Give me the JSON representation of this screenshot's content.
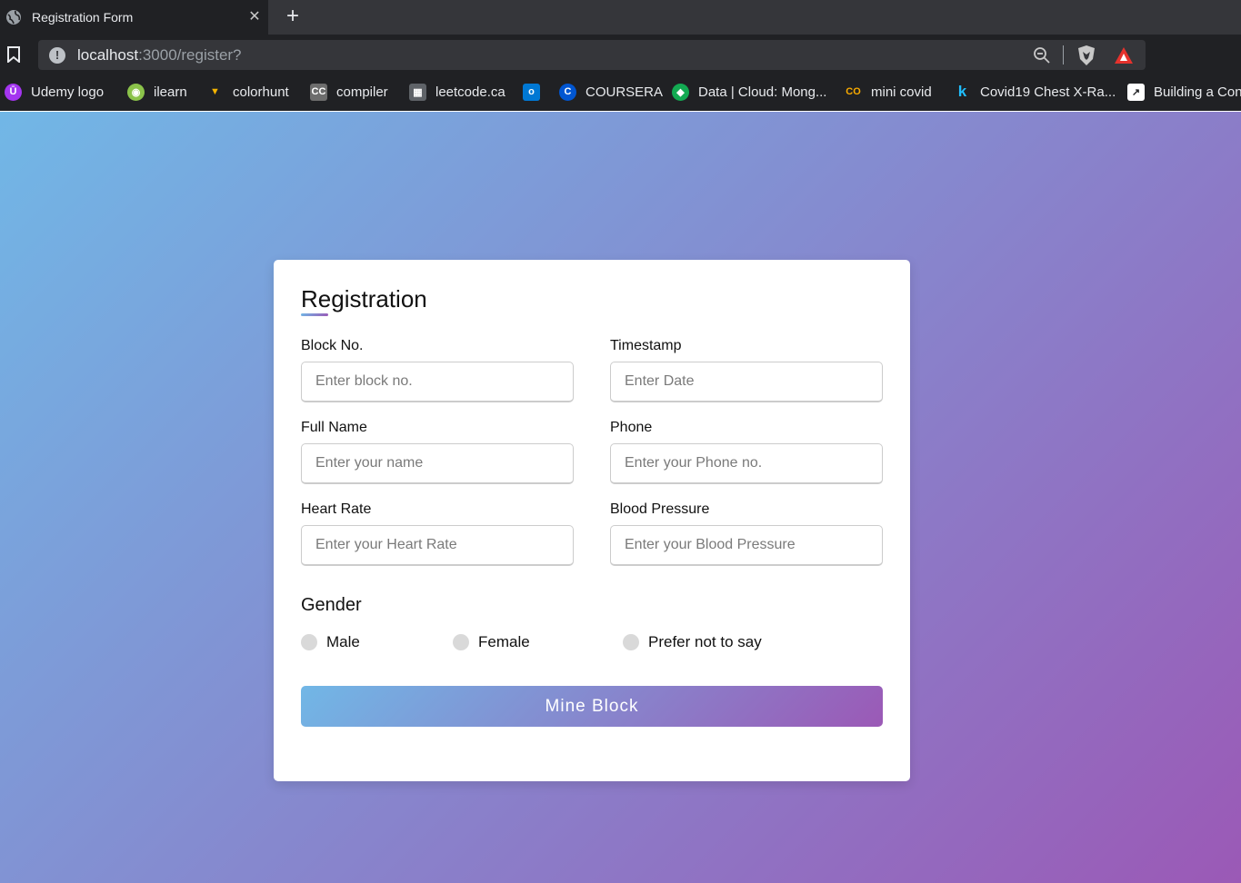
{
  "browser": {
    "tab": {
      "title": "Registration Form",
      "close_glyph": "✕"
    },
    "new_tab_glyph": "+",
    "url": {
      "host": "localhost",
      "path": ":3000/register?"
    },
    "bookmarks": [
      {
        "label": "Udemy logo",
        "icon": "udemy-icon",
        "color": "#a435f0",
        "glyph": "Ū"
      },
      {
        "label": "ilearn",
        "icon": "ilearn-icon",
        "color": "#8bc34a",
        "glyph": "◉"
      },
      {
        "label": "colorhunt",
        "icon": "colorhunt-icon",
        "color": "#f4b400",
        "glyph": "▼"
      },
      {
        "label": "compiler",
        "icon": "compiler-icon",
        "color": "#6d6d6d",
        "glyph": "CC"
      },
      {
        "label": "leetcode.ca",
        "icon": "leetcode-icon",
        "color": "#5f6368",
        "glyph": "▦"
      },
      {
        "label": "",
        "icon": "outlook-icon",
        "color": "#0078d4",
        "glyph": "o"
      },
      {
        "label": "COURSERA",
        "icon": "coursera-icon",
        "color": "#0056d2",
        "glyph": "C"
      },
      {
        "label": "Data | Cloud: Mong...",
        "icon": "mongodb-icon",
        "color": "#13aa52",
        "glyph": "◆"
      },
      {
        "label": "mini covid",
        "icon": "colab-icon",
        "color": "#f9ab00",
        "glyph": "CO"
      },
      {
        "label": "Covid19 Chest X-Ra...",
        "icon": "kaggle-icon",
        "color": "#20beff",
        "glyph": "k"
      },
      {
        "label": "Building a Con",
        "icon": "chart-icon",
        "color": "#ffffff",
        "glyph": "↗"
      }
    ]
  },
  "form": {
    "title": "Registration",
    "fields": {
      "block_no": {
        "label": "Block No.",
        "placeholder": "Enter block no."
      },
      "timestamp": {
        "label": "Timestamp",
        "placeholder": "Enter Date"
      },
      "full_name": {
        "label": "Full Name",
        "placeholder": "Enter your name"
      },
      "phone": {
        "label": "Phone",
        "placeholder": "Enter your Phone no."
      },
      "heart_rate": {
        "label": "Heart Rate",
        "placeholder": "Enter your Heart Rate"
      },
      "blood_pressure": {
        "label": "Blood Pressure",
        "placeholder": "Enter your Blood Pressure"
      }
    },
    "gender": {
      "title": "Gender",
      "options": [
        "Male",
        "Female",
        "Prefer not to say"
      ]
    },
    "submit_label": "Mine Block"
  },
  "colors": {
    "gradient_start": "#71b7e6",
    "gradient_end": "#9b59b6",
    "chrome_dark": "#202124"
  }
}
